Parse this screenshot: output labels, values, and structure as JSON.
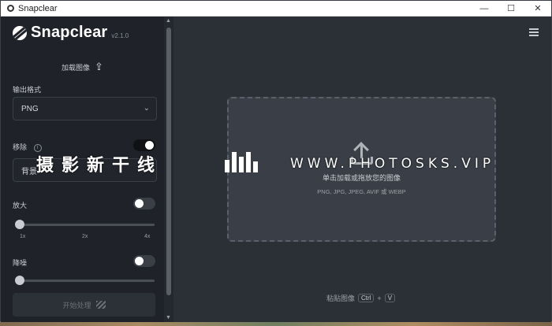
{
  "window": {
    "title": "Snapclear",
    "controls": [
      "—",
      "☐",
      "✕"
    ]
  },
  "sidebar": {
    "app_name": "Snapclear",
    "version": "v2.1.0",
    "load_image_label": "加载图像",
    "output_format_label": "输出格式",
    "output_format_value": "PNG",
    "remove_label": "移除",
    "remove_info": "i",
    "remove_toggle": true,
    "background_field": "背景",
    "upscale_label": "放大",
    "upscale_toggle": false,
    "upscale_ticks": [
      "1x",
      "2x",
      "4x"
    ],
    "denoise_label": "降噪",
    "denoise_toggle": false,
    "start_button": "开始处理"
  },
  "main": {
    "dropzone_primary": "单击加载或拖放您的图像",
    "dropzone_formats": "PNG, JPG, JPEG, AVIF 或 WEBP",
    "paste_label": "粘贴图像",
    "paste_keys": [
      "Ctrl",
      "+",
      "V"
    ]
  },
  "watermark": {
    "chinese": "摄影新干线",
    "url": "WWW.PHOTOSKS.VIP"
  },
  "icons": [
    "app-icon",
    "minimize-icon",
    "maximize-icon",
    "close-icon",
    "upload-icon",
    "chevron-down-icon",
    "info-icon",
    "menu-icon",
    "stripes-icon",
    "scroll-up-icon",
    "scroll-down-icon"
  ],
  "colors": {
    "sidebar_bg": "#1f2228",
    "main_bg": "#2b2f36",
    "dropzone_bg": "#3a3f47",
    "text": "#c9cdd2"
  }
}
